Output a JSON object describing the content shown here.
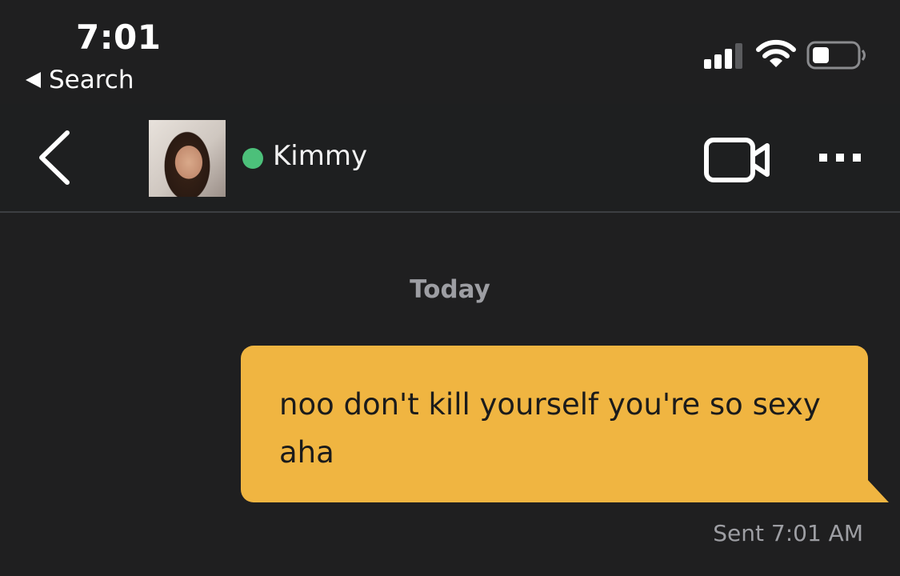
{
  "status_bar": {
    "time": "7:01",
    "back_to_app": "Search",
    "icons": [
      "cellular-signal-icon",
      "wifi-icon",
      "battery-icon"
    ]
  },
  "chat_header": {
    "contact_name": "Kimmy",
    "online": true,
    "online_color": "#4cc07a",
    "icons": [
      "back-chevron-icon",
      "video-camera-icon",
      "more-dots-icon"
    ]
  },
  "conversation": {
    "date_divider": "Today",
    "messages": [
      {
        "direction": "outgoing",
        "text": "noo don't kill yourself you're so sexy aha",
        "status": "Sent 7:01 AM",
        "bubble_color": "#f0b541"
      }
    ]
  },
  "colors": {
    "background": "#1f1f20",
    "muted_text": "#9d9ea3"
  }
}
